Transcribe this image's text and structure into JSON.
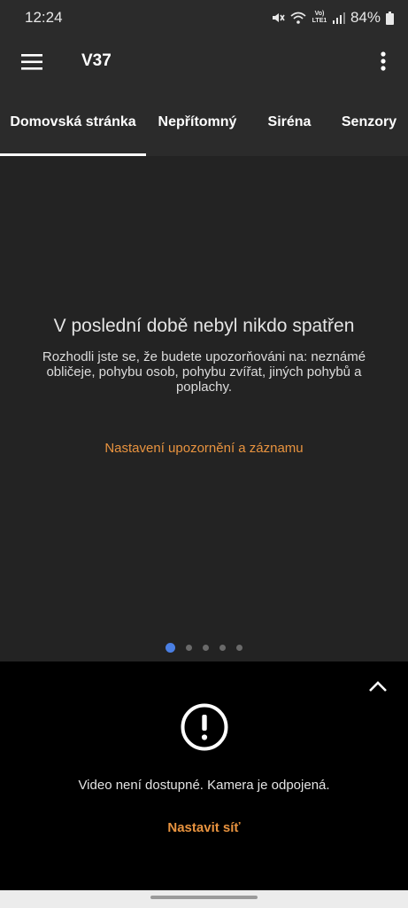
{
  "status_bar": {
    "time": "12:24",
    "battery": "84%",
    "network_label": "Vo) LTE1",
    "icons": [
      "mute-icon",
      "wifi-icon",
      "volte-icon",
      "signal-icon",
      "battery-icon"
    ]
  },
  "app_bar": {
    "title": "V37",
    "icons": [
      "menu-icon",
      "more-vert-icon"
    ]
  },
  "tabs": [
    {
      "label": "Domovská stránka",
      "active": true
    },
    {
      "label": "Nepřítomný",
      "active": false
    },
    {
      "label": "Siréna",
      "active": false
    },
    {
      "label": "Senzory",
      "active": false
    }
  ],
  "main": {
    "title": "V poslední době nebyl nikdo spatřen",
    "description": "Rozhodli jste se, že budete upozorňováni na: neznámé obličeje, pohybu osob, pohybu zvířat, jiných pohybů a poplachy.",
    "link": "Nastavení upozornění a záznamu",
    "pager": {
      "count": 5,
      "active_index": 0
    }
  },
  "bottom": {
    "icons": [
      "chevron-up-icon",
      "alert-circle-icon"
    ],
    "message": "Video není dostupné. Kamera je odpojená.",
    "link": "Nastavit síť"
  },
  "colors": {
    "accent": "#e8933f",
    "pager_active": "#4a7fe3",
    "app_bar_bg": "#2b2b2b",
    "panel_bg": "#232323",
    "bottom_bg": "#000000"
  }
}
